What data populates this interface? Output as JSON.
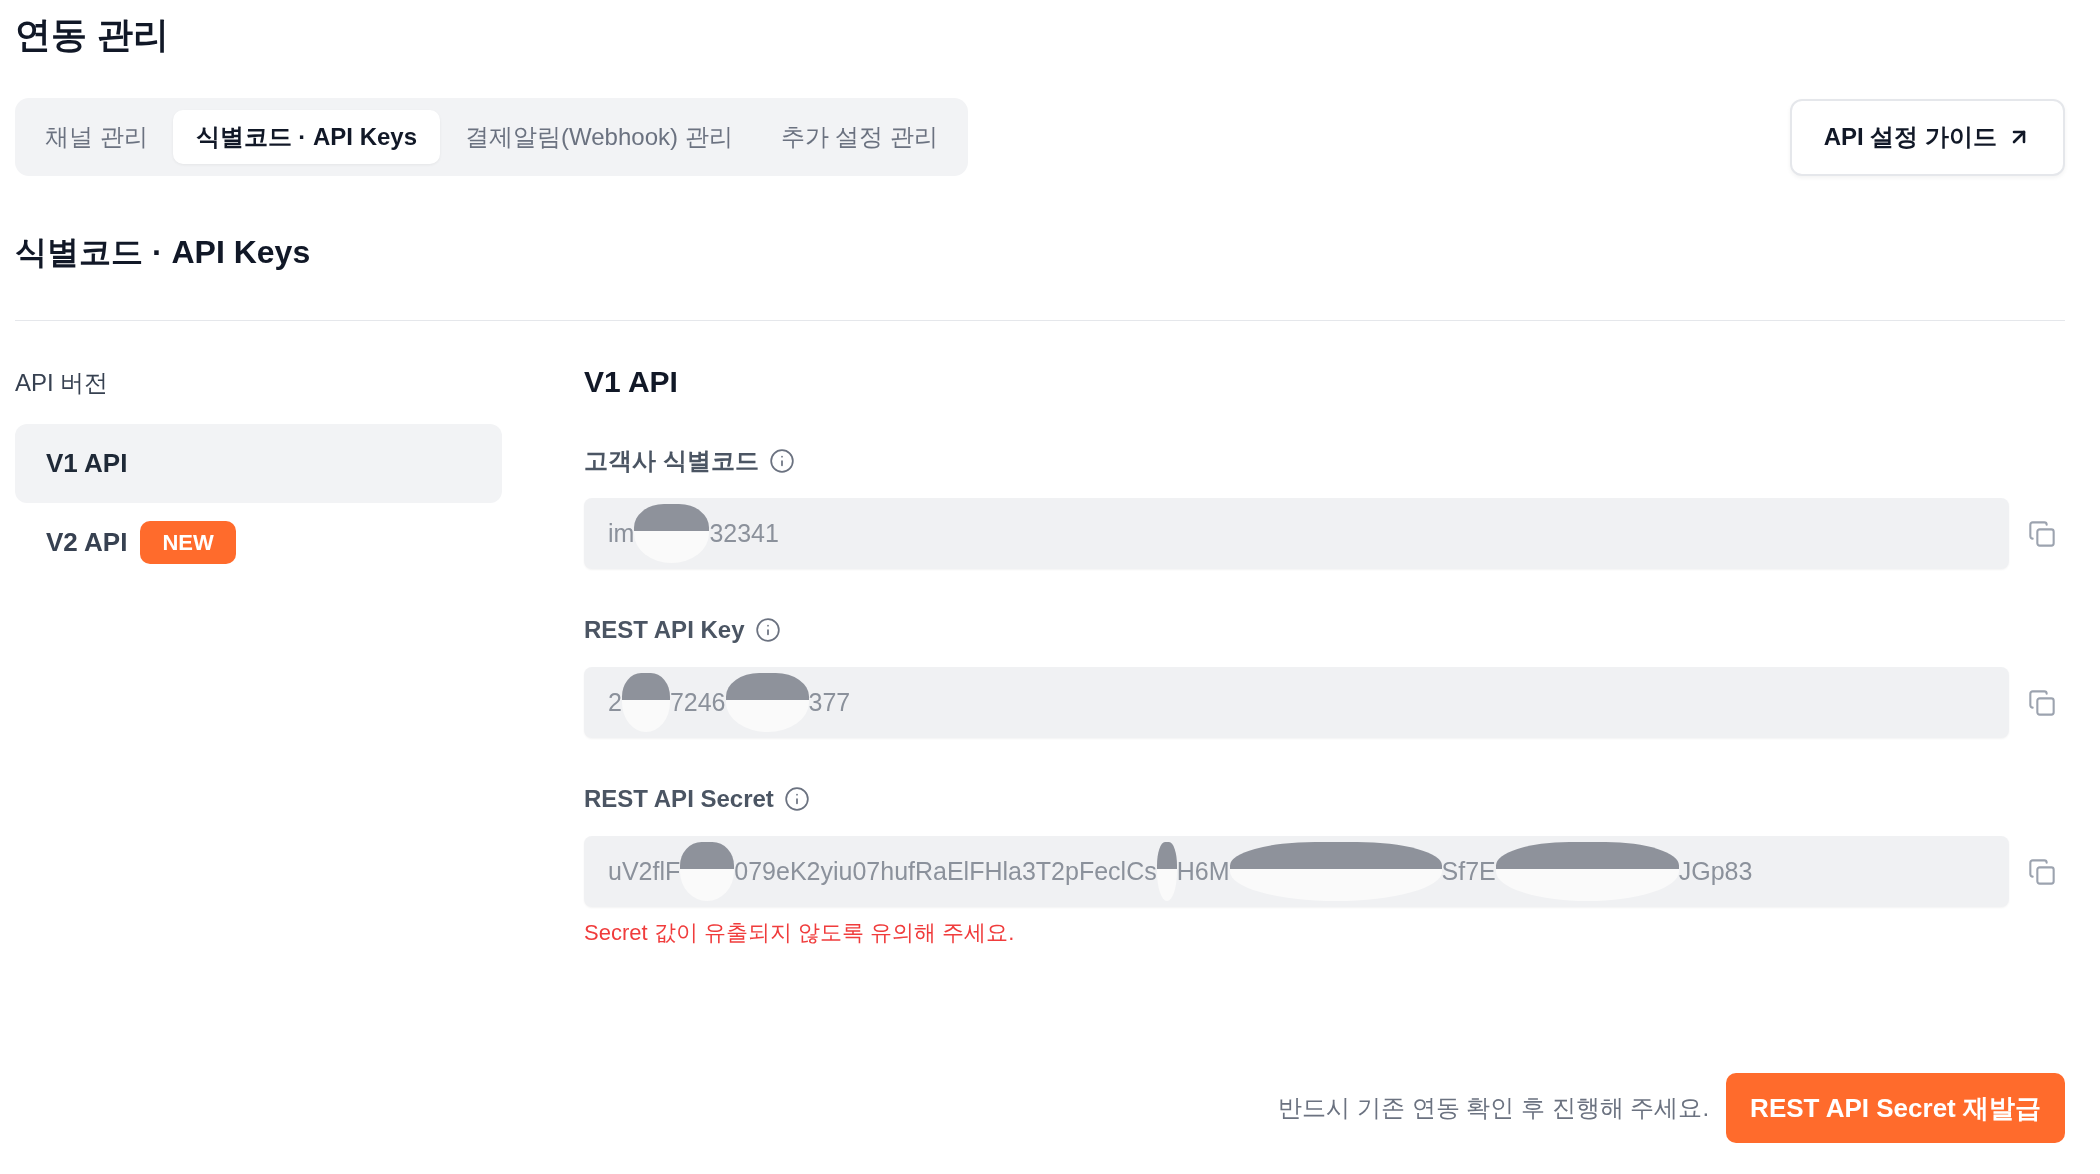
{
  "page": {
    "title": "연동 관리"
  },
  "tabs": [
    {
      "label": "채널 관리",
      "selected": false
    },
    {
      "label": "식별코드 · API Keys",
      "selected": true
    },
    {
      "label": "결제알림(Webhook) 관리",
      "selected": false
    },
    {
      "label": "추가 설정 관리",
      "selected": false
    }
  ],
  "guide_button": {
    "label": "API 설정 가이드"
  },
  "section": {
    "title": "식별코드 · API Keys"
  },
  "sidebar": {
    "title": "API 버전",
    "items": [
      {
        "label": "V1 API",
        "selected": true
      },
      {
        "label": "V2 API",
        "selected": false,
        "badge": "NEW"
      }
    ]
  },
  "panel": {
    "title": "V1 API",
    "fields": [
      {
        "label": "고객사 식별코드",
        "segments": [
          "im",
          "32341"
        ]
      },
      {
        "label": "REST API Key",
        "segments": [
          "2",
          "7246",
          "377"
        ]
      },
      {
        "label": "REST API Secret",
        "segments": [
          "uV2flF",
          "079eK2yiu07hufRaElFHla3T2pFeclCs",
          "H6M",
          "Sf7E",
          "JGp83"
        ],
        "warning": "Secret 값이 유출되지 않도록 유의해 주세요."
      }
    ]
  },
  "footer": {
    "note": "반드시 기존 연동 확인 후 진행해 주세요.",
    "button": "REST API Secret 재발급"
  }
}
